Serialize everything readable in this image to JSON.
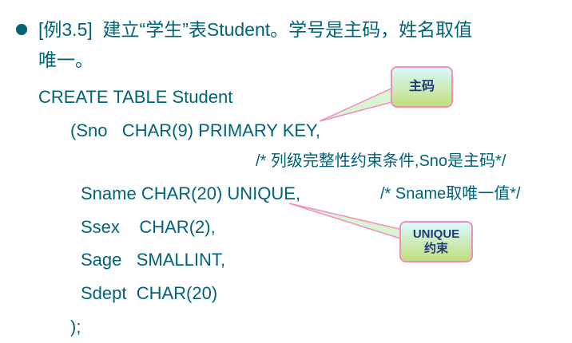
{
  "heading": {
    "line1": "[例3.5]  建立“学生”表Student。学号是主码，姓名取值",
    "line2": "唯一。"
  },
  "code": {
    "l1": "CREATE TABLE Student",
    "l2": "(Sno   CHAR(9) PRIMARY KEY,",
    "l3": "/* 列级完整性约束条件,Sno是主码*/",
    "l4": "Sname CHAR(20) UNIQUE,",
    "l4c": "/* Sname取唯一值*/",
    "l5": "Ssex    CHAR(2),",
    "l6": "Sage   SMALLINT,",
    "l7": "Sdept  CHAR(20)",
    "l8": ");"
  },
  "callouts": {
    "pk": "主码",
    "unique1": "UNIQUE",
    "unique2": "约束"
  },
  "colors": {
    "text": "#006478",
    "callout_border": "#f28cc0",
    "callout_text": "#1e3a7c"
  }
}
